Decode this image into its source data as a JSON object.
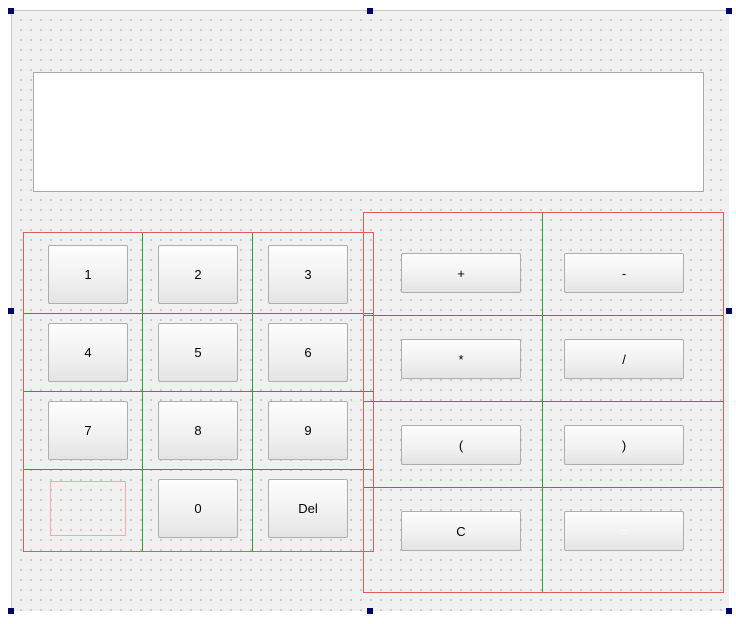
{
  "display": {
    "value": ""
  },
  "digits": {
    "one": "1",
    "two": "2",
    "three": "3",
    "four": "4",
    "five": "5",
    "six": "6",
    "seven": "7",
    "eight": "8",
    "nine": "9",
    "zero": "0",
    "del": "Del"
  },
  "operators": {
    "plus": "+",
    "minus": "-",
    "multiply": "*",
    "divide": "/",
    "open_paren": "(",
    "close_paren": ")",
    "clear": "C",
    "equals": "="
  },
  "colors": {
    "layout_frame": "#e05a5a",
    "grid_line": "#2e9e2e",
    "selection_handle": "#000066"
  }
}
